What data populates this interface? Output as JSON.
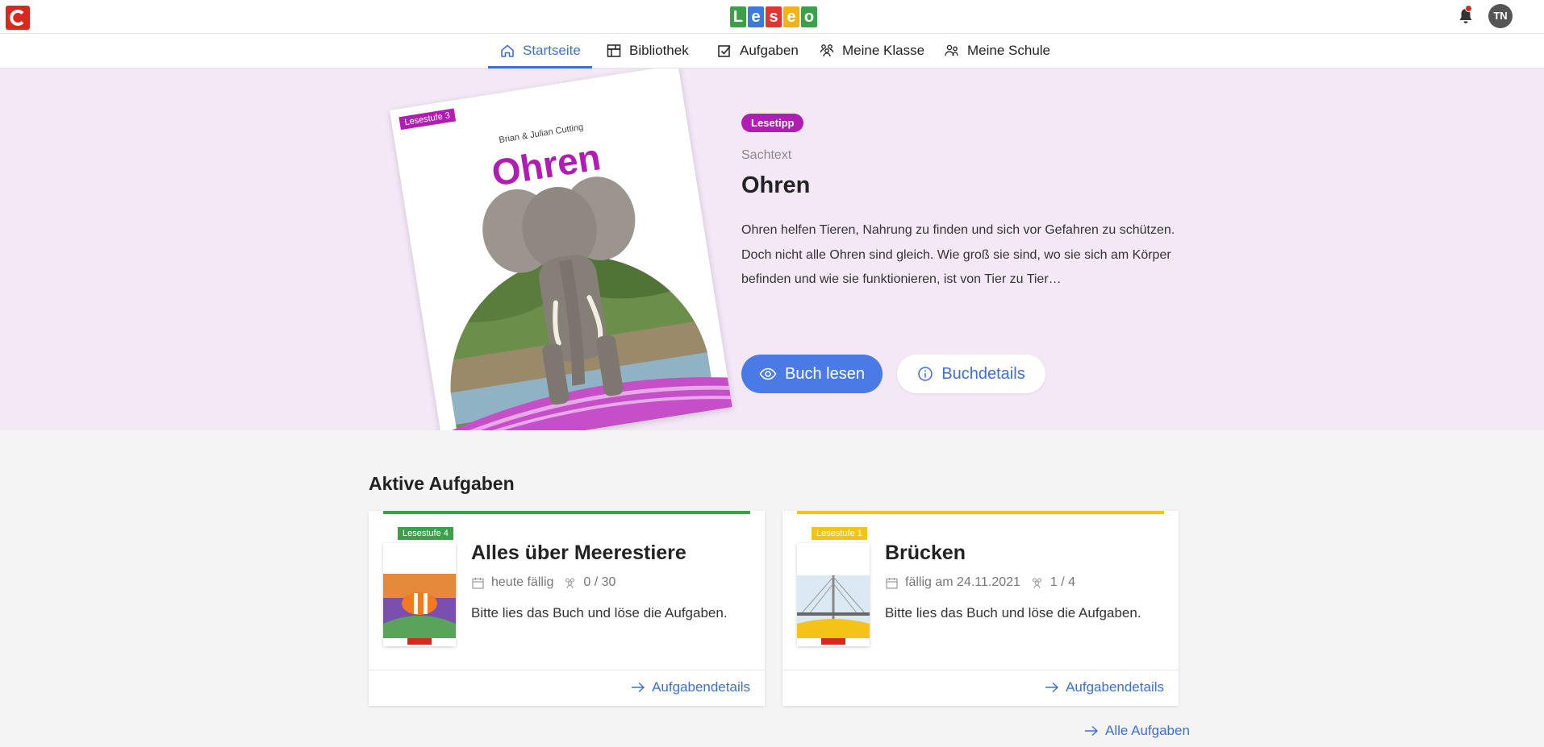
{
  "header": {
    "brand_letter": "C",
    "logo_letters": [
      "L",
      "e",
      "s",
      "e",
      "o"
    ],
    "logo_colors": [
      "#3aa04a",
      "#3b7be0",
      "#e3342f",
      "#f3b316",
      "#3aa04a"
    ],
    "avatar_initials": "TN"
  },
  "nav": {
    "items": [
      {
        "label": "Startseite",
        "icon": "home-icon",
        "active": true
      },
      {
        "label": "Bibliothek",
        "icon": "library-icon",
        "active": false
      },
      {
        "label": "Aufgaben",
        "icon": "tasks-icon",
        "active": false
      },
      {
        "label": "Meine Klasse",
        "icon": "class-icon",
        "active": false
      },
      {
        "label": "Meine Schule",
        "icon": "school-icon",
        "active": false
      }
    ]
  },
  "hero": {
    "badge": "Lesetipp",
    "genre": "Sachtext",
    "title": "Ohren",
    "description": "Ohren helfen Tieren, Nahrung zu finden und sich vor Gefahren zu schützen. Doch nicht alle Ohren sind gleich. Wie groß sie sind, wo sie sich am Körper befinden und wie sie funktionieren, ist von Tier zu Tier…",
    "read_button": "Buch lesen",
    "details_button": "Buchdetails",
    "book": {
      "level_badge": "Lesestufe 3",
      "author": "Brian & Julian Cutting",
      "title": "Ohren"
    }
  },
  "tasks": {
    "section_title": "Aktive Aufgaben",
    "cards": [
      {
        "title": "Alles über Meerestiere",
        "level_badge": "Lesestufe 4",
        "level_color": "#3aa04a",
        "due": "heute fällig",
        "progress": "0 / 30",
        "text": "Bitte lies das Buch und löse die Aufgaben.",
        "link": "Aufgabendetails"
      },
      {
        "title": "Brücken",
        "level_badge": "Lesestufe 1",
        "level_color": "#f3c316",
        "due": "fällig am 24.11.2021",
        "progress": "1 / 4",
        "text": "Bitte lies das Buch und löse die Aufgaben.",
        "link": "Aufgabendetails"
      }
    ],
    "all_link": "Alle Aufgaben"
  }
}
